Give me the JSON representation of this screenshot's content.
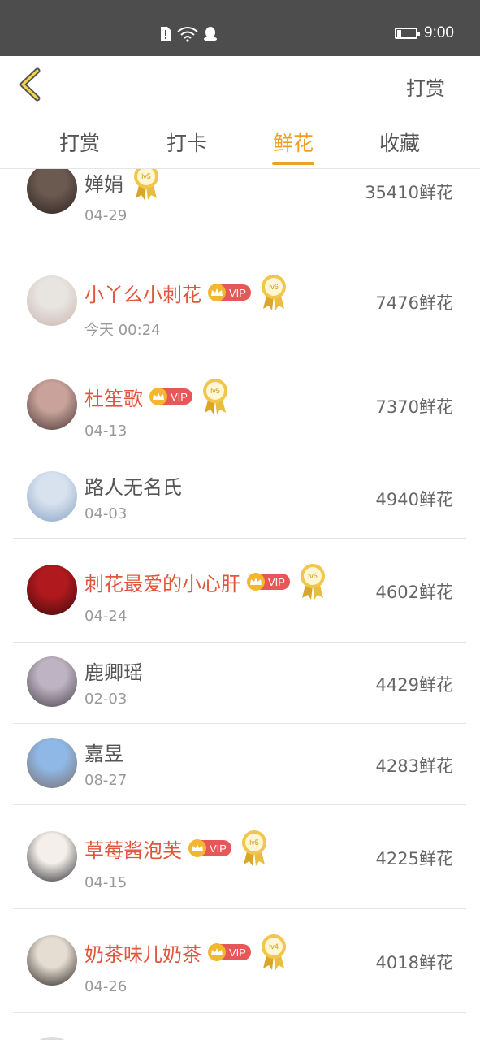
{
  "status_bar": {
    "time": "9:00"
  },
  "header": {
    "right_action": "打赏"
  },
  "tabs": [
    {
      "label": "打赏"
    },
    {
      "label": "打卡"
    },
    {
      "label": "鲜花"
    },
    {
      "label": "收藏"
    }
  ],
  "rows": [
    {
      "name": "婵娟",
      "date": "04-29",
      "count": "35410鲜花",
      "vip": false,
      "level": "lv5",
      "vip_label": ""
    },
    {
      "name": "小丫么小刺花",
      "date": "今天 00:24",
      "count": "7476鲜花",
      "vip": true,
      "level": "lv6",
      "vip_label": "VIP"
    },
    {
      "name": "杜笙歌",
      "date": "04-13",
      "count": "7370鲜花",
      "vip": true,
      "level": "lv5",
      "vip_label": "VIP"
    },
    {
      "name": "路人无名氏",
      "date": "04-03",
      "count": "4940鲜花",
      "vip": false,
      "level": "",
      "vip_label": ""
    },
    {
      "name": "刺花最爱的小心肝",
      "date": "04-24",
      "count": "4602鲜花",
      "vip": true,
      "level": "lv6",
      "vip_label": "VIP"
    },
    {
      "name": "鹿卿瑶",
      "date": "02-03",
      "count": "4429鲜花",
      "vip": false,
      "level": "",
      "vip_label": ""
    },
    {
      "name": "嘉昱",
      "date": "08-27",
      "count": "4283鲜花",
      "vip": false,
      "level": "",
      "vip_label": ""
    },
    {
      "name": "草莓酱泡芙",
      "date": "04-15",
      "count": "4225鲜花",
      "vip": true,
      "level": "lv5",
      "vip_label": "VIP"
    },
    {
      "name": "奶茶味儿奶茶",
      "date": "04-26",
      "count": "4018鲜花",
      "vip": true,
      "level": "lv4",
      "vip_label": "VIP"
    }
  ],
  "colors": {
    "accent": "#f0a020",
    "vip_name": "#e2553d",
    "status_bar": "#4d4d4d"
  }
}
